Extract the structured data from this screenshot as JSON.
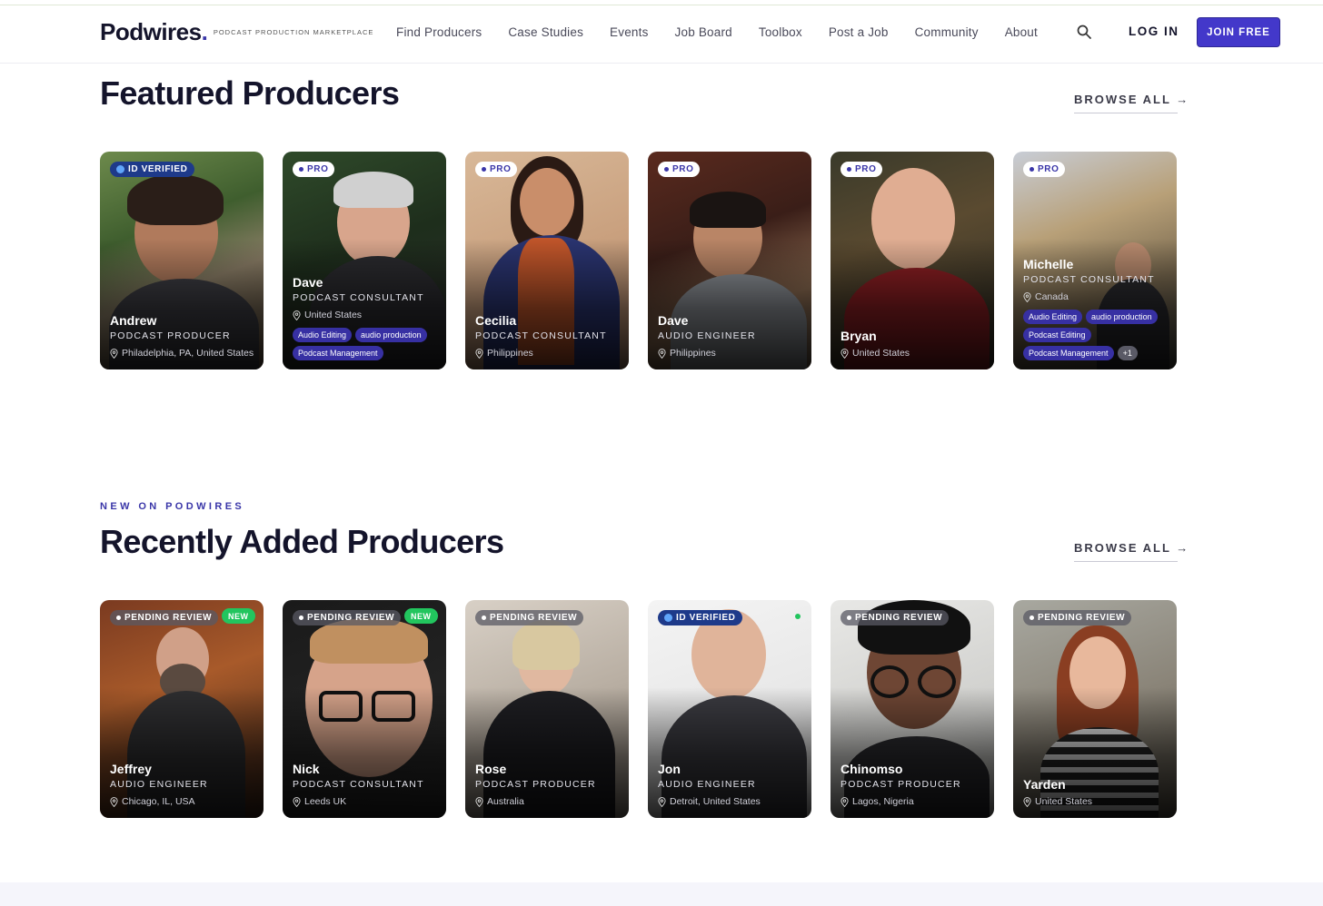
{
  "brand": {
    "name": "Podwires",
    "dot": ".",
    "tagline": "PODCAST PRODUCTION MARKETPLACE"
  },
  "nav": [
    "Find Producers",
    "Case Studies",
    "Events",
    "Job Board",
    "Toolbox",
    "Post a Job",
    "Community",
    "About"
  ],
  "auth": {
    "login": "LOG IN",
    "join": "JOIN FREE"
  },
  "featured": {
    "title": "Featured Producers",
    "browse": "BROWSE ALL →",
    "cards": [
      {
        "badge": "ID VERIFIED",
        "name": "Andrew",
        "role": "PODCAST PRODUCER",
        "location": "Philadelphia, PA, United States",
        "tags": []
      },
      {
        "badge": "PRO",
        "name": "Dave",
        "role": "PODCAST CONSULTANT",
        "location": "United States",
        "tags": [
          "Audio Editing",
          "audio production",
          "Podcast Management"
        ]
      },
      {
        "badge": "PRO",
        "name": "Cecilia",
        "role": "PODCAST CONSULTANT",
        "location": "Philippines",
        "tags": []
      },
      {
        "badge": "PRO",
        "name": "Dave",
        "role": "AUDIO ENGINEER",
        "location": "Philippines",
        "tags": []
      },
      {
        "badge": "PRO",
        "name": "Bryan",
        "role": "",
        "location": "United States",
        "tags": []
      },
      {
        "badge": "PRO",
        "name": "Michelle",
        "role": "PODCAST CONSULTANT",
        "location": "Canada",
        "tags": [
          "Audio Editing",
          "audio production",
          "Podcast Editing",
          "Podcast Management",
          "+1"
        ]
      }
    ]
  },
  "recent": {
    "eyebrow": "NEW ON PODWIRES",
    "title": "Recently Added Producers",
    "browse": "BROWSE ALL →",
    "cards": [
      {
        "badge": "PENDING REVIEW",
        "new": "NEW",
        "name": "Jeffrey",
        "role": "AUDIO ENGINEER",
        "location": "Chicago, IL, USA"
      },
      {
        "badge": "PENDING REVIEW",
        "new": "NEW",
        "name": "Nick",
        "role": "PODCAST CONSULTANT",
        "location": "Leeds UK"
      },
      {
        "badge": "PENDING REVIEW",
        "new": "",
        "name": "Rose",
        "role": "PODCAST PRODUCER",
        "location": "Australia"
      },
      {
        "badge": "ID VERIFIED",
        "new": "",
        "name": "Jon",
        "role": "AUDIO ENGINEER",
        "location": "Detroit, United States"
      },
      {
        "badge": "PENDING REVIEW",
        "new": "",
        "name": "Chinomso",
        "role": "PODCAST PRODUCER",
        "location": "Lagos, Nigeria"
      },
      {
        "badge": "PENDING REVIEW",
        "new": "",
        "name": "Yarden",
        "role": "",
        "location": "United States"
      }
    ]
  },
  "colors": {
    "accent": "#4338ca",
    "verified": "#1e3a8a",
    "new": "#22c55e",
    "tag": "#3730a3"
  }
}
